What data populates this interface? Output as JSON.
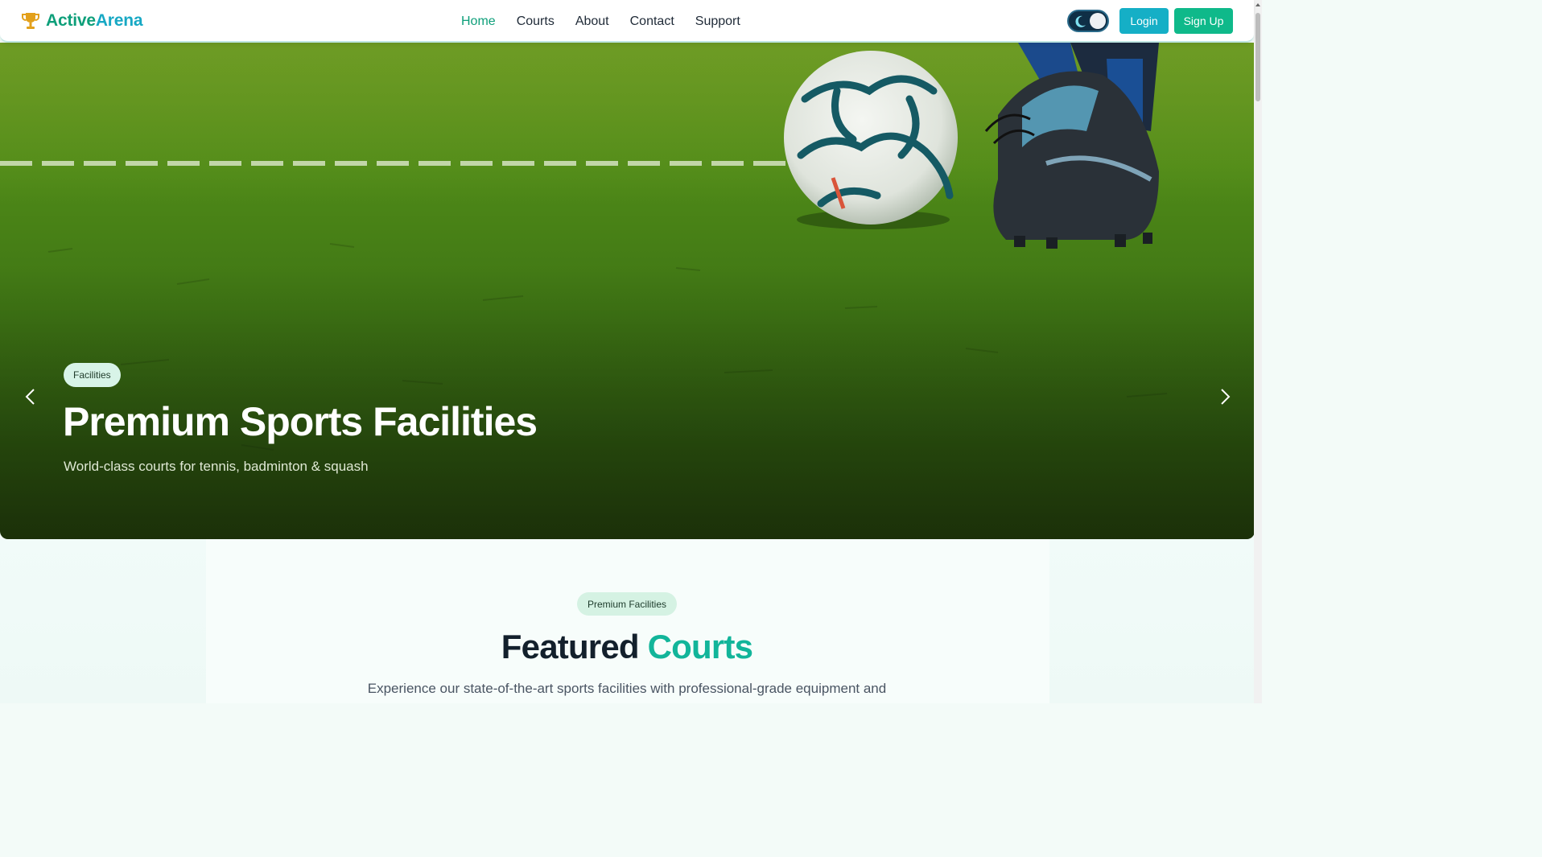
{
  "brand": {
    "part1": "Active",
    "part2": "Arena",
    "icon": "trophy-icon",
    "colors": {
      "part1": "#0e9f7a",
      "part2": "#17a8c4",
      "icon": "#e3a01b"
    }
  },
  "nav": {
    "items": [
      {
        "label": "Home",
        "active": true
      },
      {
        "label": "Courts",
        "active": false
      },
      {
        "label": "About",
        "active": false
      },
      {
        "label": "Contact",
        "active": false
      },
      {
        "label": "Support",
        "active": false
      }
    ],
    "active_color": "#0e9f7a"
  },
  "header_actions": {
    "theme_toggle_icon": "moon-icon",
    "login_label": "Login",
    "signup_label": "Sign Up",
    "login_color": "#15afc6",
    "signup_color": "#0fb98a"
  },
  "hero": {
    "tag": "Facilities",
    "title": "Premium Sports Facilities",
    "subtitle": "World-class courts for tennis, badminton & squash",
    "prev_icon": "chevron-left-icon",
    "next_icon": "chevron-right-icon"
  },
  "featured": {
    "pill": "Premium Facilities",
    "title_main": "Featured",
    "title_accent": "Courts",
    "description": "Experience our state-of-the-art sports facilities with professional-grade equipment and",
    "accent_color": "#12b59a"
  }
}
